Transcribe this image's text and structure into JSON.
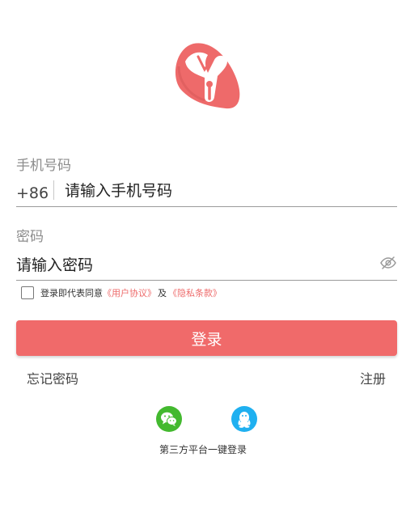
{
  "app": {
    "logo_icon": "app-logo-y",
    "brand_color": "#f06a6a"
  },
  "phone": {
    "label": "手机号码",
    "country_code": "+86",
    "placeholder": "请输入手机号码"
  },
  "password": {
    "label": "密码",
    "placeholder": "请输入密码",
    "toggle_icon": "eye-hidden-icon"
  },
  "agreement": {
    "prefix": "登录即代表同意",
    "user_agreement": "《用户协议》",
    "and": "及",
    "privacy_policy": "《隐私条款》",
    "link_color": "#ee6b6b"
  },
  "actions": {
    "login_label": "登录",
    "forgot_label": "忘记密码",
    "register_label": "注册"
  },
  "social": {
    "wechat_icon": "wechat-icon",
    "wechat_color": "#43b92f",
    "qq_icon": "qq-icon",
    "qq_color": "#1fb0f0",
    "caption": "第三方平台一键登录"
  }
}
